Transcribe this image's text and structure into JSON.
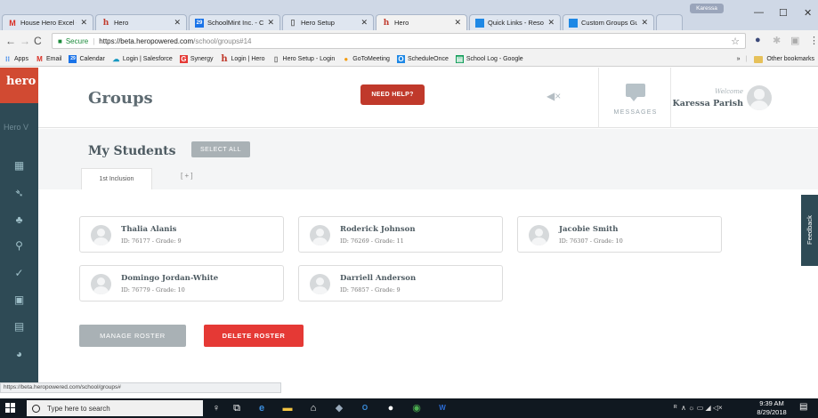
{
  "browser": {
    "profile": "Karessa",
    "tabs": [
      {
        "label": "House Hero Excel -",
        "icon": "gmail-icon",
        "active": false
      },
      {
        "label": "Hero",
        "icon": "hero-h-icon",
        "active": false
      },
      {
        "label": "SchoolMint Inc. - C",
        "icon": "calendar-icon",
        "active": false
      },
      {
        "label": "Hero Setup",
        "icon": "doc-icon",
        "active": false
      },
      {
        "label": "Hero",
        "icon": "hero-h-icon",
        "active": true
      },
      {
        "label": "Quick Links - Resou",
        "icon": "sm-icon",
        "active": false
      },
      {
        "label": "Custom Groups Gu",
        "icon": "sm-icon",
        "active": false
      }
    ],
    "window_controls": {
      "minimize": "—",
      "maximize": "☐",
      "close": "✕"
    },
    "address": {
      "secure_label": "Secure",
      "url_host": "https://beta.heropowered.com",
      "url_path": "/school/groups#14"
    },
    "bookmarks": [
      {
        "label": "Apps",
        "icon": "apps-icon"
      },
      {
        "label": "Email",
        "icon": "gmail-icon"
      },
      {
        "label": "Calendar",
        "icon": "calendar-icon"
      },
      {
        "label": "Login | Salesforce",
        "icon": "salesforce-icon"
      },
      {
        "label": "Synergy",
        "icon": "synergy-icon"
      },
      {
        "label": "Login | Hero",
        "icon": "hero-h-icon"
      },
      {
        "label": "Hero Setup - Login",
        "icon": "doc-icon"
      },
      {
        "label": "GoToMeeting",
        "icon": "gotomeeting-icon"
      },
      {
        "label": "ScheduleOnce",
        "icon": "scheduleonce-icon"
      },
      {
        "label": "School Log - Google",
        "icon": "sheets-icon"
      }
    ],
    "bookmarks_overflow": "»",
    "other_bookmarks": "Other bookmarks",
    "status_url": "https://beta.heropowered.com/school/groups#"
  },
  "app": {
    "logo": "hero",
    "side_label": "Hero V",
    "page_title": "Groups",
    "help_label": "NEED HELP?",
    "messages_label": "MESSAGES",
    "welcome": "Welcome",
    "user_name": "Karessa Parish",
    "section_title": "My Students",
    "select_all_label": "SELECT ALL",
    "group_tab": "1st Inclusion",
    "add_tab": "[ + ]",
    "students": [
      {
        "name": "Thalia Alanis",
        "info": "ID: 76177 - Grade: 9"
      },
      {
        "name": "Roderick Johnson",
        "info": "ID: 76269 - Grade: 11"
      },
      {
        "name": "Jacobie Smith",
        "info": "ID: 76307 - Grade: 10"
      },
      {
        "name": "Domingo Jordan-White",
        "info": "ID: 76779 - Grade: 10"
      },
      {
        "name": "Darriell Anderson",
        "info": "ID: 76857 - Grade: 9"
      }
    ],
    "manage_label": "MANAGE ROSTER",
    "delete_label": "DELETE ROSTER",
    "feedback_label": "Feedback"
  },
  "taskbar": {
    "search_placeholder": "Type here to search",
    "time": "9:39 AM",
    "date": "8/29/2018"
  },
  "colors": {
    "brand_red": "#d14a32",
    "nav_dark": "#2e4a55",
    "delete_red": "#e53935",
    "help_red": "#c0392b",
    "neutral_button": "#a9b1b5"
  }
}
